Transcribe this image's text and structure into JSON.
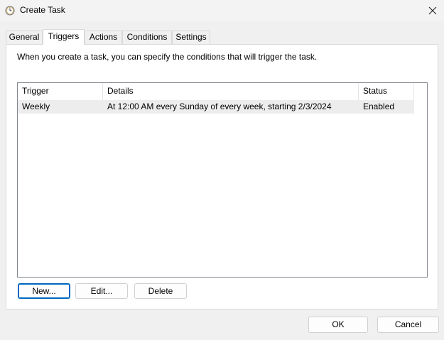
{
  "window": {
    "title": "Create Task"
  },
  "tabs": [
    {
      "label": "General"
    },
    {
      "label": "Triggers"
    },
    {
      "label": "Actions"
    },
    {
      "label": "Conditions"
    },
    {
      "label": "Settings"
    }
  ],
  "active_tab": "Triggers",
  "triggers_tab": {
    "intro": "When you create a task, you can specify the conditions that will trigger the task.",
    "columns": [
      "Trigger",
      "Details",
      "Status"
    ],
    "rows": [
      {
        "trigger": "Weekly",
        "details": "At 12:00 AM every Sunday of every week, starting 2/3/2024",
        "status": "Enabled"
      }
    ],
    "buttons": {
      "new": "New...",
      "edit": "Edit...",
      "delete": "Delete"
    }
  },
  "footer": {
    "ok": "OK",
    "cancel": "Cancel"
  },
  "icons": {
    "title": "clock-icon",
    "close": "close-icon"
  },
  "colors": {
    "window_bg": "#f0f0f0",
    "panel_bg": "#ffffff",
    "selected_row": "#ededed",
    "default_button_border": "#0067c0"
  }
}
